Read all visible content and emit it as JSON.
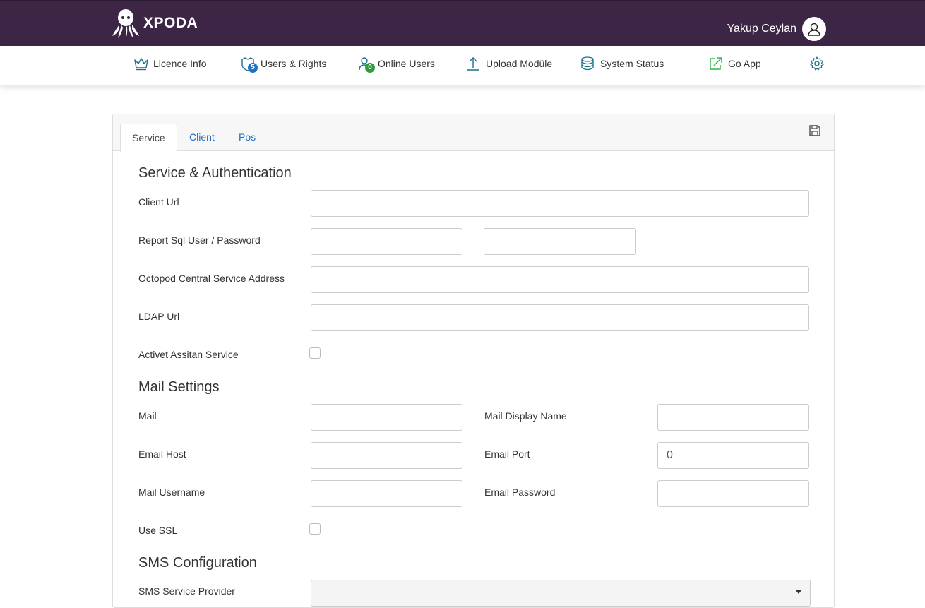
{
  "header": {
    "brand": "XPODA",
    "user_name": "Yakup Ceylan"
  },
  "nav": {
    "licence": "Licence Info",
    "users_rights": "Users & Rights",
    "users_rights_badge": "5",
    "online_users": "Online Users",
    "online_users_badge": "0",
    "upload": "Upload Modüle",
    "system_status": "System Status",
    "go_app": "Go App"
  },
  "tabs": [
    "Service",
    "Client",
    "Pos"
  ],
  "service_auth": {
    "title": "Service & Authentication",
    "client_url": "Client Url",
    "report_sql": "Report Sql User / Password",
    "central_service": "Octopod Central Service Address",
    "ldap_url": "LDAP Url",
    "assistant_service": "Activet Assitan Service"
  },
  "mail": {
    "title": "Mail Settings",
    "mail": "Mail",
    "display_name": "Mail Display Name",
    "email_host": "Email Host",
    "email_port": "Email Port",
    "email_port_value": "0",
    "mail_username": "Mail Username",
    "email_password": "Email Password",
    "use_ssl": "Use SSL"
  },
  "sms": {
    "title": "SMS Configuration",
    "provider": "SMS Service Provider"
  },
  "colors": {
    "header_bg": "#3d2546",
    "link": "#1a73c9",
    "badge_blue": "#1a73c9",
    "badge_green": "#2e9b3c",
    "go_app_icon": "#2eb84b",
    "nav_icon": "#1b6f8c"
  }
}
